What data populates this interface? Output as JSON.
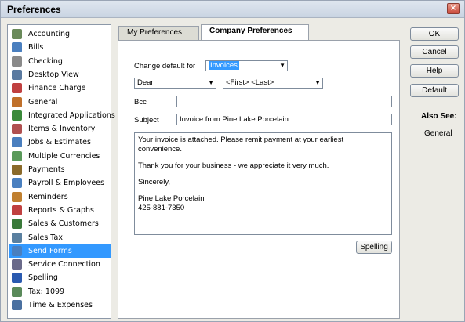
{
  "window": {
    "title": "Preferences",
    "close_label": "×"
  },
  "sidebar": {
    "items": [
      {
        "label": "Accounting",
        "icon": "accounting-icon",
        "color": "#6a8a5a"
      },
      {
        "label": "Bills",
        "icon": "bills-icon",
        "color": "#4a7fbf"
      },
      {
        "label": "Checking",
        "icon": "checking-icon",
        "color": "#8a8a8a"
      },
      {
        "label": "Desktop View",
        "icon": "desktop-view-icon",
        "color": "#5a7aa0"
      },
      {
        "label": "Finance Charge",
        "icon": "finance-charge-icon",
        "color": "#c04040"
      },
      {
        "label": "General",
        "icon": "general-icon",
        "color": "#c0702a"
      },
      {
        "label": "Integrated Applications",
        "icon": "integrated-apps-icon",
        "color": "#3a8a3a"
      },
      {
        "label": "Items & Inventory",
        "icon": "items-inventory-icon",
        "color": "#b05050"
      },
      {
        "label": "Jobs & Estimates",
        "icon": "jobs-estimates-icon",
        "color": "#4a7fbf"
      },
      {
        "label": "Multiple Currencies",
        "icon": "multiple-currencies-icon",
        "color": "#5a9a5a"
      },
      {
        "label": "Payments",
        "icon": "payments-icon",
        "color": "#8a6a2a"
      },
      {
        "label": "Payroll & Employees",
        "icon": "payroll-icon",
        "color": "#4a80c0"
      },
      {
        "label": "Reminders",
        "icon": "reminders-icon",
        "color": "#c08030"
      },
      {
        "label": "Reports & Graphs",
        "icon": "reports-graphs-icon",
        "color": "#c04040"
      },
      {
        "label": "Sales & Customers",
        "icon": "sales-customers-icon",
        "color": "#3a7a3a"
      },
      {
        "label": "Sales Tax",
        "icon": "sales-tax-icon",
        "color": "#5a80a0"
      },
      {
        "label": "Send Forms",
        "icon": "send-forms-icon",
        "color": "#4a7fbf",
        "selected": true
      },
      {
        "label": "Service Connection",
        "icon": "service-connection-icon",
        "color": "#6a6a8a"
      },
      {
        "label": "Spelling",
        "icon": "spelling-icon",
        "color": "#2a5ab0"
      },
      {
        "label": "Tax: 1099",
        "icon": "tax-1099-icon",
        "color": "#5a8a5a"
      },
      {
        "label": "Time & Expenses",
        "icon": "time-expenses-icon",
        "color": "#4a70a0"
      }
    ]
  },
  "tabs": [
    {
      "label": "My Preferences"
    },
    {
      "label": "Company Preferences",
      "active": true
    }
  ],
  "form": {
    "change_default_label": "Change default for",
    "change_default_value": "Invoices",
    "salutation_value": "Dear",
    "name_format_value": "<First> <Last>",
    "bcc_label": "Bcc",
    "bcc_value": "",
    "subject_label": "Subject",
    "subject_value": "Invoice from Pine Lake Porcelain",
    "body_paragraphs": [
      "Your invoice is attached.  Please remit payment at your earliest convenience.",
      "Thank you for your business - we appreciate it very much.",
      "Sincerely,",
      "Pine Lake Porcelain\n425-881-7350"
    ],
    "spelling_button": "Spelling"
  },
  "buttons": {
    "ok": "OK",
    "cancel": "Cancel",
    "help": "Help",
    "default": "Default"
  },
  "also_see": {
    "title": "Also See:",
    "links": [
      "General"
    ]
  },
  "colors": {
    "selection": "#3399ff"
  }
}
